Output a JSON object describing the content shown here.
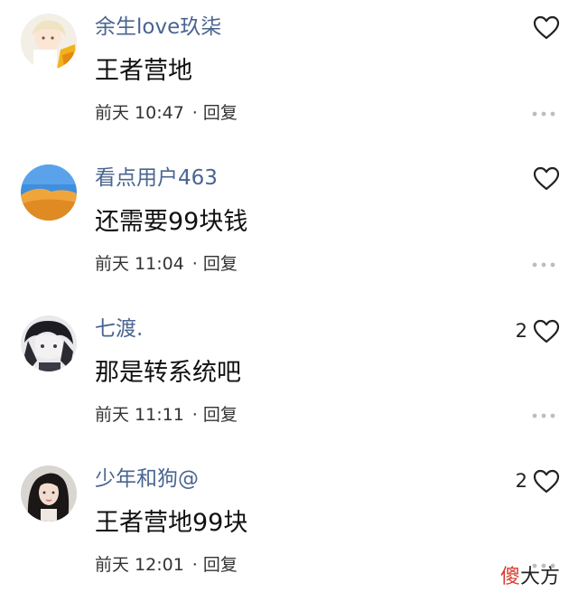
{
  "comments": [
    {
      "username": "余生love玖柒",
      "text": "王者营地",
      "time": "前天 10:47",
      "reply_label": "回复",
      "likes": "",
      "avatar": "anime-character-yellow"
    },
    {
      "username": "看点用户463",
      "text": "还需要99块钱",
      "time": "前天 11:04",
      "reply_label": "回复",
      "likes": "",
      "avatar": "desert-dune"
    },
    {
      "username": "七渡.",
      "text": "那是转系统吧",
      "time": "前天 11:11",
      "reply_label": "回复",
      "likes": "2",
      "avatar": "dark-anime-boy"
    },
    {
      "username": "少年和狗@",
      "text": "王者营地99块",
      "time": "前天 12:01",
      "reply_label": "回复",
      "likes": "2",
      "avatar": "girl-portrait"
    }
  ],
  "separator": "·",
  "watermark": {
    "part1": "傻",
    "part2": "大方"
  },
  "colors": {
    "username": "#4a6590",
    "text": "#111111",
    "meta": "#333333",
    "watermark_red": "#d83a2e"
  }
}
